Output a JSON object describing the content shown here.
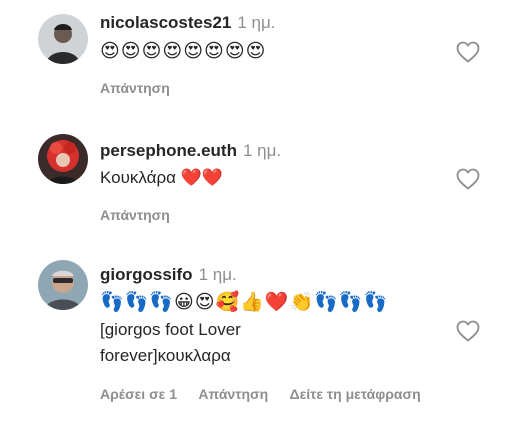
{
  "comments": [
    {
      "username": "nicolascostes21",
      "time": "1 ημ.",
      "body": "😍😍😍😍😍😍😍😍",
      "actions": {
        "reply": "Απάντηση"
      }
    },
    {
      "username": "persephone.euth",
      "time": "1 ημ.",
      "body_text": "Κουκλάρα",
      "body_emoji": "❤️❤️",
      "actions": {
        "reply": "Απάντηση"
      }
    },
    {
      "username": "giorgossifo",
      "time": "1 ημ.",
      "emoji_line": "👣👣👣😀😍🥰👍❤️👏👣👣👣",
      "body_line1": "[giorgos foot Lover",
      "body_line2": "forever]κουκλαρα",
      "actions": {
        "likes": "Αρέσει σε 1",
        "reply": "Απάντηση",
        "translate": "Δείτε τη μετάφραση"
      }
    }
  ],
  "icons": {
    "like": "heart-outline-icon"
  },
  "colors": {
    "text": "#262626",
    "secondary": "#8e8e8e",
    "background": "#ffffff"
  }
}
